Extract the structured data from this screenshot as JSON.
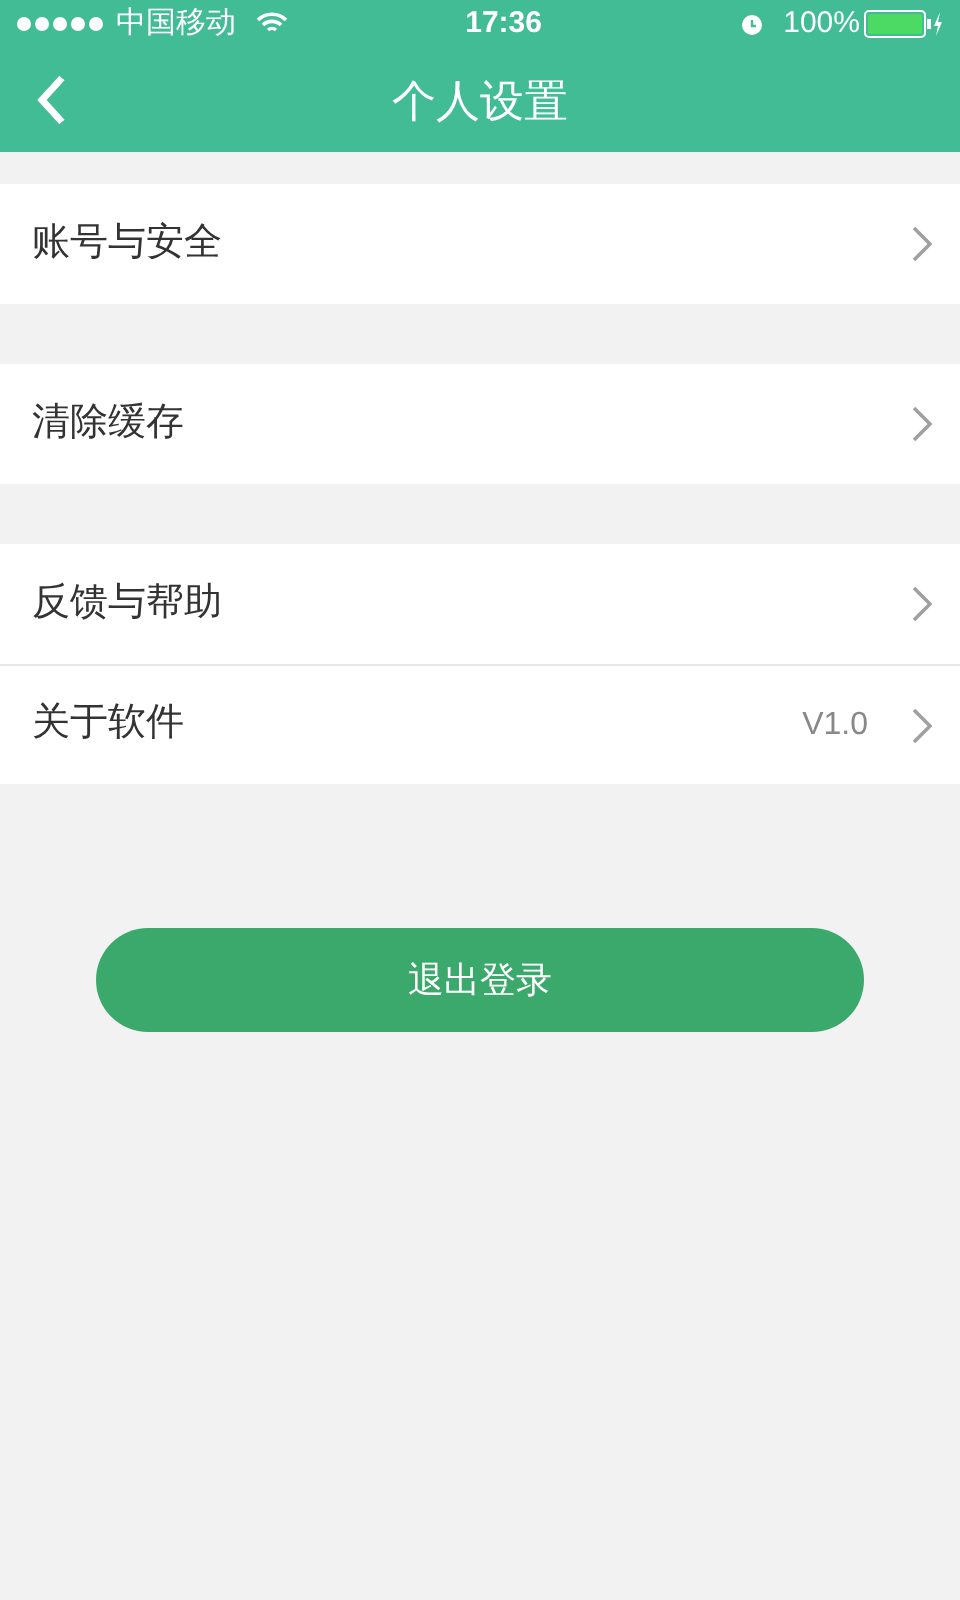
{
  "status_bar": {
    "carrier": "中国移动",
    "time": "17:36",
    "battery": "100%"
  },
  "nav": {
    "title": "个人设置"
  },
  "groups": [
    {
      "items": [
        {
          "label": "账号与安全"
        }
      ]
    },
    {
      "items": [
        {
          "label": "清除缓存"
        }
      ]
    },
    {
      "items": [
        {
          "label": "反馈与帮助"
        },
        {
          "label": "关于软件",
          "value": "V1.0"
        }
      ]
    }
  ],
  "logout_button": "退出登录"
}
